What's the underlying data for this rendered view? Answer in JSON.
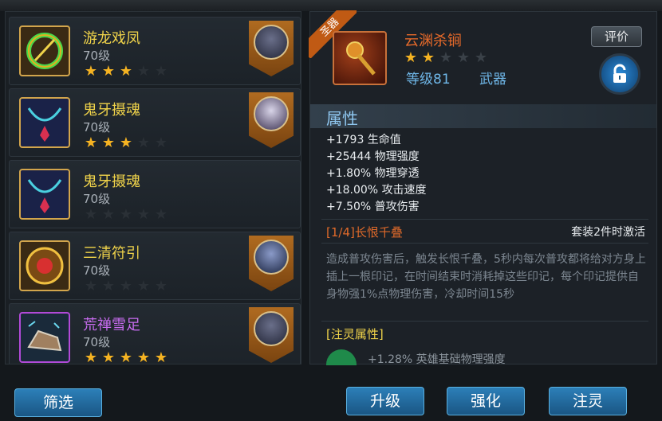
{
  "left_list": [
    {
      "name": "游龙戏凤",
      "level": "70级",
      "stars": 3,
      "name_color": "#f0d34a",
      "frame": "gold",
      "has_hero": true
    },
    {
      "name": "鬼牙摄魂",
      "level": "70级",
      "stars": 3,
      "name_color": "#f0d34a",
      "frame": "gold",
      "has_hero": true
    },
    {
      "name": "鬼牙摄魂",
      "level": "70级",
      "stars": 0,
      "name_color": "#f0d34a",
      "frame": "gold",
      "has_hero": false
    },
    {
      "name": "三清符引",
      "level": "70级",
      "stars": 0,
      "name_color": "#f0d34a",
      "frame": "gold",
      "has_hero": true
    },
    {
      "name": "荒禅雪足",
      "level": "70级",
      "stars": 5,
      "name_color": "#c86cf0",
      "frame": "purple",
      "has_hero": true
    }
  ],
  "detail": {
    "ribbon": "圣器",
    "name": "云渊杀锏",
    "stars": 2,
    "level": "等级81",
    "type": "武器",
    "review_label": "评价",
    "attr_title": "属性",
    "stats": [
      "+1793 生命值",
      "+25444 物理强度",
      "+1.80% 物理穿透",
      "+18.00% 攻击速度",
      "+7.50% 普攻伤害"
    ],
    "set_title": "[1/4]长恨千叠",
    "set_condition": "套装2件时激活",
    "set_desc": "造成普攻伤害后，触发长恨千叠，5秒内每次普攻都将给对方身上插上一根印记，在时间结束时消耗掉这些印记，每个印记提供自身物强1%点物理伤害，冷却时间15秒",
    "spirit_title": "[注灵属性]",
    "spirit_stat": "+1.28% 英雄基础物理强度"
  },
  "buttons": {
    "filter": "筛选",
    "upgrade": "升级",
    "enhance": "强化",
    "infuse": "注灵"
  },
  "colors": {
    "accent_blue": "#2c7fb8",
    "gold_text": "#f0d34a",
    "orange_text": "#e66a2a",
    "star_on": "#f5b322"
  }
}
